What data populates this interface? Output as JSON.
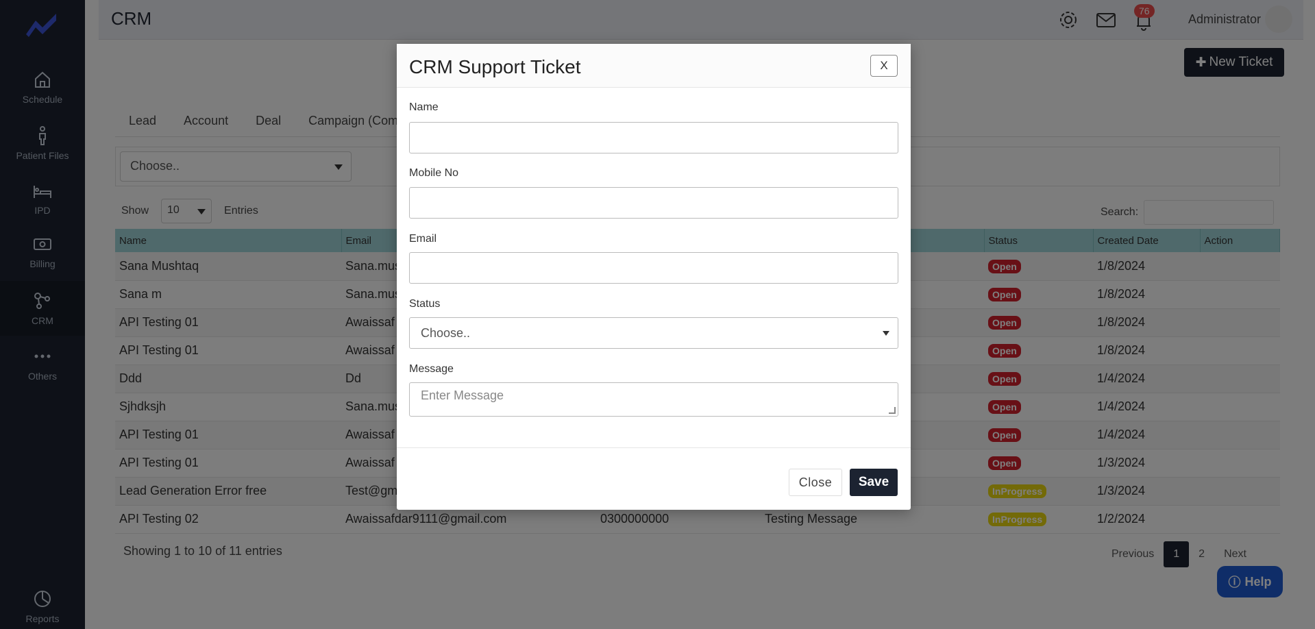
{
  "app": {
    "title": "CRM",
    "user": "Administrator",
    "notification_count": "76"
  },
  "colors": {
    "sidebar": "#1c2331",
    "table_header": "#9ed3d6",
    "open": "#d0202c",
    "in_progress": "#e6d411",
    "help": "#1f5bd1"
  },
  "sidebar": {
    "items": [
      {
        "label": "Schedule",
        "icon": "home-icon"
      },
      {
        "label": "Patient Files",
        "icon": "person-icon"
      },
      {
        "label": "IPD",
        "icon": "bed-icon"
      },
      {
        "label": "Billing",
        "icon": "money-icon"
      },
      {
        "label": "CRM",
        "icon": "network-icon"
      },
      {
        "label": "Others",
        "icon": "ellipsis-icon"
      },
      {
        "label": "Reports",
        "icon": "pie-chart-icon"
      }
    ]
  },
  "toolbar": {
    "new_ticket": "New Ticket"
  },
  "tabs": [
    "Lead",
    "Account",
    "Deal",
    "Campaign (Com"
  ],
  "filter": {
    "value": "Choose.."
  },
  "table_controls": {
    "show": "Show",
    "entries_value": "10",
    "entries": "Entries",
    "search": "Search:"
  },
  "table": {
    "headers": [
      "Name",
      "Email",
      "",
      "",
      "Status",
      "Created Date",
      "Action"
    ],
    "rows": [
      {
        "name": "Sana Mushtaq",
        "email": "Sana.mus",
        "phone": "",
        "message": "",
        "status": "Open",
        "date": "1/8/2024"
      },
      {
        "name": "Sana m",
        "email": "Sana.mus",
        "phone": "",
        "message": "",
        "status": "Open",
        "date": "1/8/2024"
      },
      {
        "name": "API Testing 01",
        "email": "Awaissaf",
        "phone": "",
        "message": "",
        "status": "Open",
        "date": "1/8/2024"
      },
      {
        "name": "API Testing 01",
        "email": "Awaissaf",
        "phone": "",
        "message": "",
        "status": "Open",
        "date": "1/8/2024"
      },
      {
        "name": "Ddd",
        "email": "Dd",
        "phone": "",
        "message": "",
        "status": "Open",
        "date": "1/4/2024"
      },
      {
        "name": "Sjhdksjh",
        "email": "Sana.mus",
        "phone": "",
        "message": "",
        "status": "Open",
        "date": "1/4/2024"
      },
      {
        "name": "API Testing 01",
        "email": "Awaissaf",
        "phone": "",
        "message": "",
        "status": "Open",
        "date": "1/4/2024"
      },
      {
        "name": "API Testing 01",
        "email": "Awaissaf",
        "phone": "",
        "message": "",
        "status": "Open",
        "date": "1/3/2024"
      },
      {
        "name": "Lead Generation Error free",
        "email": "Test@gm",
        "phone": "",
        "message": "",
        "status": "InProgress",
        "date": "1/3/2024"
      },
      {
        "name": "API Testing 02",
        "email": "Awaissafdar9111@gmail.com",
        "phone": "0300000000",
        "message": "Testing Message",
        "status": "InProgress",
        "date": "1/2/2024"
      }
    ]
  },
  "footer": {
    "showing": "Showing 1 to 10 of 11 entries"
  },
  "pagination": {
    "previous": "Previous",
    "page1": "1",
    "page2": "2",
    "next": "Next"
  },
  "help": {
    "label": "Help"
  },
  "modal": {
    "title": "CRM Support Ticket",
    "close_x": "X",
    "fields": {
      "name_label": "Name",
      "name_value": "",
      "mobile_label": "Mobile No",
      "mobile_value": "",
      "email_label": "Email",
      "email_value": "",
      "status_label": "Status",
      "status_value": "Choose..",
      "message_label": "Message",
      "message_placeholder": "Enter Message"
    },
    "close_button": "Close",
    "save_button": "Save"
  }
}
